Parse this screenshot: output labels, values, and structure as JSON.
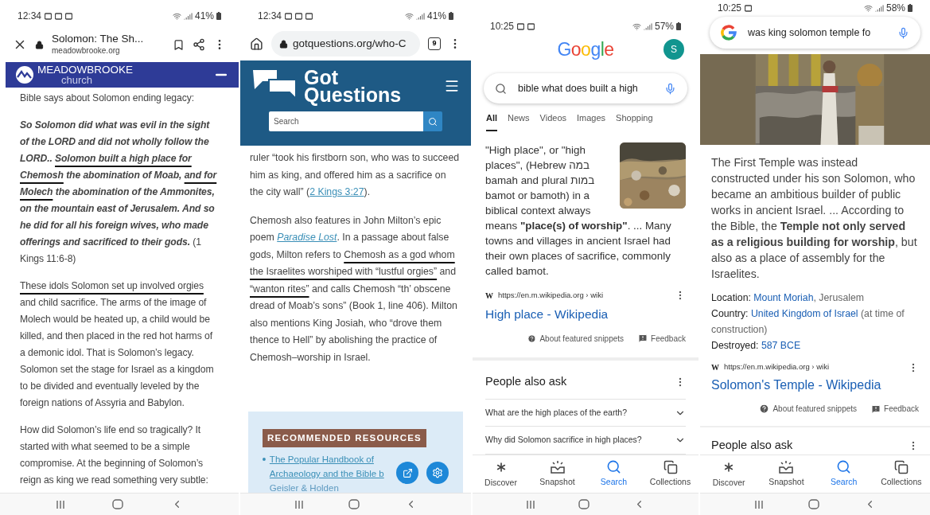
{
  "meadowbrooke_page": {
    "status_bar": {
      "time": "12:34",
      "battery": "41%"
    },
    "toolbar": {
      "title": "Solomon: The Sh...",
      "url": "meadowbrooke.org"
    },
    "site_header": {
      "name": "MEADOWBROOKE",
      "subtitle": "church"
    },
    "paragraphs": [
      [
        {
          "kind": "plain",
          "text": "Bible says about Solomon ending legacy:"
        }
      ],
      [
        {
          "kind": "italic",
          "text": "So Solomon did what was evil in the sight of the LORD and did not wholly follow the LORD.. "
        },
        {
          "kind": "marked-italic",
          "text": "Solomon built a high place for Chemosh"
        },
        {
          "kind": "italic",
          "text": " the abomination of Moab, "
        },
        {
          "kind": "marked-italic",
          "text": "and for Molech"
        },
        {
          "kind": "italic",
          "text": " the abomination of the Ammonites, on the mountain east of Jerusalem. And so he did for all his foreign wives, who made offerings and sacrificed to their gods."
        },
        {
          "kind": "plain",
          "text": " (1 Kings 11:6-8)"
        }
      ],
      [
        {
          "kind": "marked",
          "text": "These idols Solomon set up involved orgies"
        },
        {
          "kind": "plain",
          "text": " and child sacrifice. The arms of the image of Molech would be heated up, a child would be killed, and then placed in the red hot harms of a demonic idol. That is Solomon’s legacy. Solomon set the stage for Israel as a kingdom to be divided and eventually leveled by the foreign nations of Assyria and Babylon."
        }
      ],
      [
        {
          "kind": "plain",
          "text": "How did Solomon’s life end so tragically? It started with what seemed to be a simple compromise. At the beginning of Solomon’s reign as king we read something very subtle:"
        }
      ]
    ]
  },
  "gotquestions_page": {
    "status_bar": {
      "time": "12:34",
      "battery": "41%"
    },
    "toolbar": {
      "url": "gotquestions.org/who-C",
      "tab_count": "9"
    },
    "site_header": {
      "logo_lines": [
        "Got",
        "Questions"
      ],
      "search_placeholder": "Search"
    },
    "paragraphs": [
      [
        {
          "kind": "plain",
          "text": "ruler “took his firstborn son, who was to succeed him as king, and offered him as a sacrifice on the city wall” ("
        },
        {
          "kind": "link",
          "text": "2 Kings 3:27"
        },
        {
          "kind": "plain",
          "text": ")."
        }
      ],
      [
        {
          "kind": "plain",
          "text": "Chemosh also features in John Milton’s epic poem "
        },
        {
          "kind": "link-italic",
          "text": "Paradise Lost"
        },
        {
          "kind": "plain",
          "text": ". In a passage about false gods, Milton refers to "
        },
        {
          "kind": "marked",
          "text": "Chemosh as a god whom the Israelites worshiped with “lustful orgies”"
        },
        {
          "kind": "plain",
          "text": " and "
        },
        {
          "kind": "marked",
          "text": "“wanton rites”"
        },
        {
          "kind": "plain",
          "text": " and calls Chemosh “th’ obscene dread of Moab’s sons” (Book 1, line 406). Milton also mentions King Josiah, who “drove them thence to Hell” by abolishing the practice of Chemosh–worship in Israel."
        }
      ]
    ],
    "resources": {
      "heading": "RECOMMENDED RESOURCES",
      "items": [
        {
          "title": "The Popular Handbook of Archaeology and the Bible b",
          "author": "Geisler & Holden"
        }
      ]
    }
  },
  "google_search_high_place": {
    "status_bar": {
      "time": "10:25",
      "battery": "57%"
    },
    "logo": "Google",
    "account_initial": "S",
    "query": "bible what does built a high",
    "tabs": [
      {
        "label": "All",
        "selected": true
      },
      {
        "label": "News",
        "selected": false
      },
      {
        "label": "Videos",
        "selected": false
      },
      {
        "label": "Images",
        "selected": false
      },
      {
        "label": "Shopping",
        "selected": false
      }
    ],
    "snippet": {
      "text_beside_image": "\"High place\", or \"high places\", (Hebrew במה bamah and plural במות bamot or bamoth) in a biblical context always",
      "text_below_image": "means **\"place(s) of worship\"**. ... Many towns and villages in ancient Israel had their own places of sacrifice, commonly called bamot.",
      "source_letter": "W",
      "source_url": "https://en.m.wikipedia.org › wiki",
      "title": "High place - Wikipedia",
      "about": "About featured snippets",
      "feedback": "Feedback"
    },
    "people_also_ask": {
      "heading": "People also ask",
      "questions": [
        {
          "text": "What are the high places of the earth?",
          "expanded": false
        },
        {
          "text": "Why did Solomon sacrifice in high places?",
          "expanded": false
        }
      ]
    },
    "bottom_nav": [
      {
        "label": "Discover",
        "selected": false
      },
      {
        "label": "Snapshot",
        "selected": false
      },
      {
        "label": "Search",
        "selected": true
      },
      {
        "label": "Collections",
        "selected": false
      }
    ]
  },
  "google_search_temple": {
    "status_bar": {
      "time": "10:25",
      "battery": "58%"
    },
    "query": "was king solomon temple fo",
    "snippet": {
      "text": "The First Temple was instead constructed under his son Solomon, who became an ambitious builder of public works in ancient Israel. ... According to the Bible, the **Temple not only served as a religious building for worship**, but also as a place of assembly for the Israelites.",
      "facts": [
        {
          "label": "Location:",
          "parts": [
            {
              "kind": "link",
              "text": "Mount Moriah"
            },
            {
              "kind": "plain",
              "text": ", Jerusalem"
            }
          ]
        },
        {
          "label": "Country:",
          "parts": [
            {
              "kind": "link",
              "text": "United Kingdom of Israel"
            },
            {
              "kind": "plain",
              "text": " (at time of construction)"
            }
          ]
        },
        {
          "label": "Destroyed:",
          "parts": [
            {
              "kind": "link",
              "text": "587 BCE"
            }
          ]
        }
      ],
      "source_letter": "W",
      "source_url": "https://en.m.wikipedia.org › wiki",
      "title": "Solomon's Temple - Wikipedia",
      "about": "About featured snippets",
      "feedback": "Feedback"
    },
    "people_also_ask": {
      "heading": "People also ask"
    },
    "bottom_nav": [
      {
        "label": "Discover",
        "selected": false
      },
      {
        "label": "Snapshot",
        "selected": false
      },
      {
        "label": "Search",
        "selected": true
      },
      {
        "label": "Collections",
        "selected": false
      }
    ]
  }
}
